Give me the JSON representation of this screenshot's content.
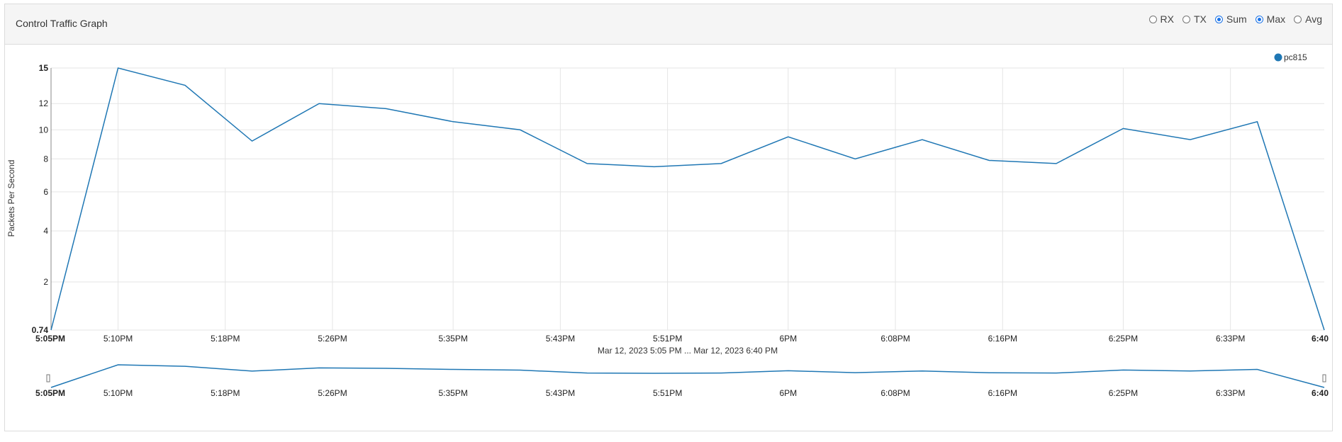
{
  "panel": {
    "title": "Control Traffic Graph",
    "options": [
      {
        "label": "RX",
        "checked": false
      },
      {
        "label": "TX",
        "checked": false
      },
      {
        "label": "Sum",
        "checked": true
      },
      {
        "label": "Max",
        "checked": true
      },
      {
        "label": "Avg",
        "checked": false
      }
    ]
  },
  "colors": {
    "series": "#1f77b4",
    "grid": "#e5e5e5",
    "accent": "#1a73e8"
  },
  "chart_data": {
    "type": "line",
    "ylabel": "Packets Per Second",
    "xlabel": "",
    "range_label": "Mar 12, 2023 5:05 PM ... Mar 12, 2023 6:40 PM",
    "ylim": [
      0.74,
      15
    ],
    "y_scale": "sqrt",
    "yticks": [
      "0.74",
      "2",
      "4",
      "6",
      "8",
      "10",
      "12",
      "15"
    ],
    "xticks": [
      "5:05PM",
      "5:10PM",
      "5:18PM",
      "5:26PM",
      "5:35PM",
      "5:43PM",
      "5:51PM",
      "6PM",
      "6:08PM",
      "6:16PM",
      "6:25PM",
      "6:33PM",
      "6:40"
    ],
    "grid": true,
    "legend_position": "top-right",
    "series": [
      {
        "name": "pc815",
        "x": [
          "5:05PM",
          "5:10PM",
          "5:15PM",
          "5:20PM",
          "5:25PM",
          "5:30PM",
          "5:35PM",
          "5:40PM",
          "5:45PM",
          "5:50PM",
          "5:55PM",
          "6:00PM",
          "6:05PM",
          "6:10PM",
          "6:15PM",
          "6:20PM",
          "6:25PM",
          "6:30PM",
          "6:35PM",
          "6:40PM"
        ],
        "values": [
          0.74,
          15,
          13.5,
          9.2,
          12,
          11.6,
          10.6,
          10,
          7.7,
          7.5,
          7.7,
          9.5,
          8.0,
          9.3,
          7.9,
          7.7,
          10.1,
          9.3,
          10.6,
          0.74
        ]
      }
    ]
  }
}
